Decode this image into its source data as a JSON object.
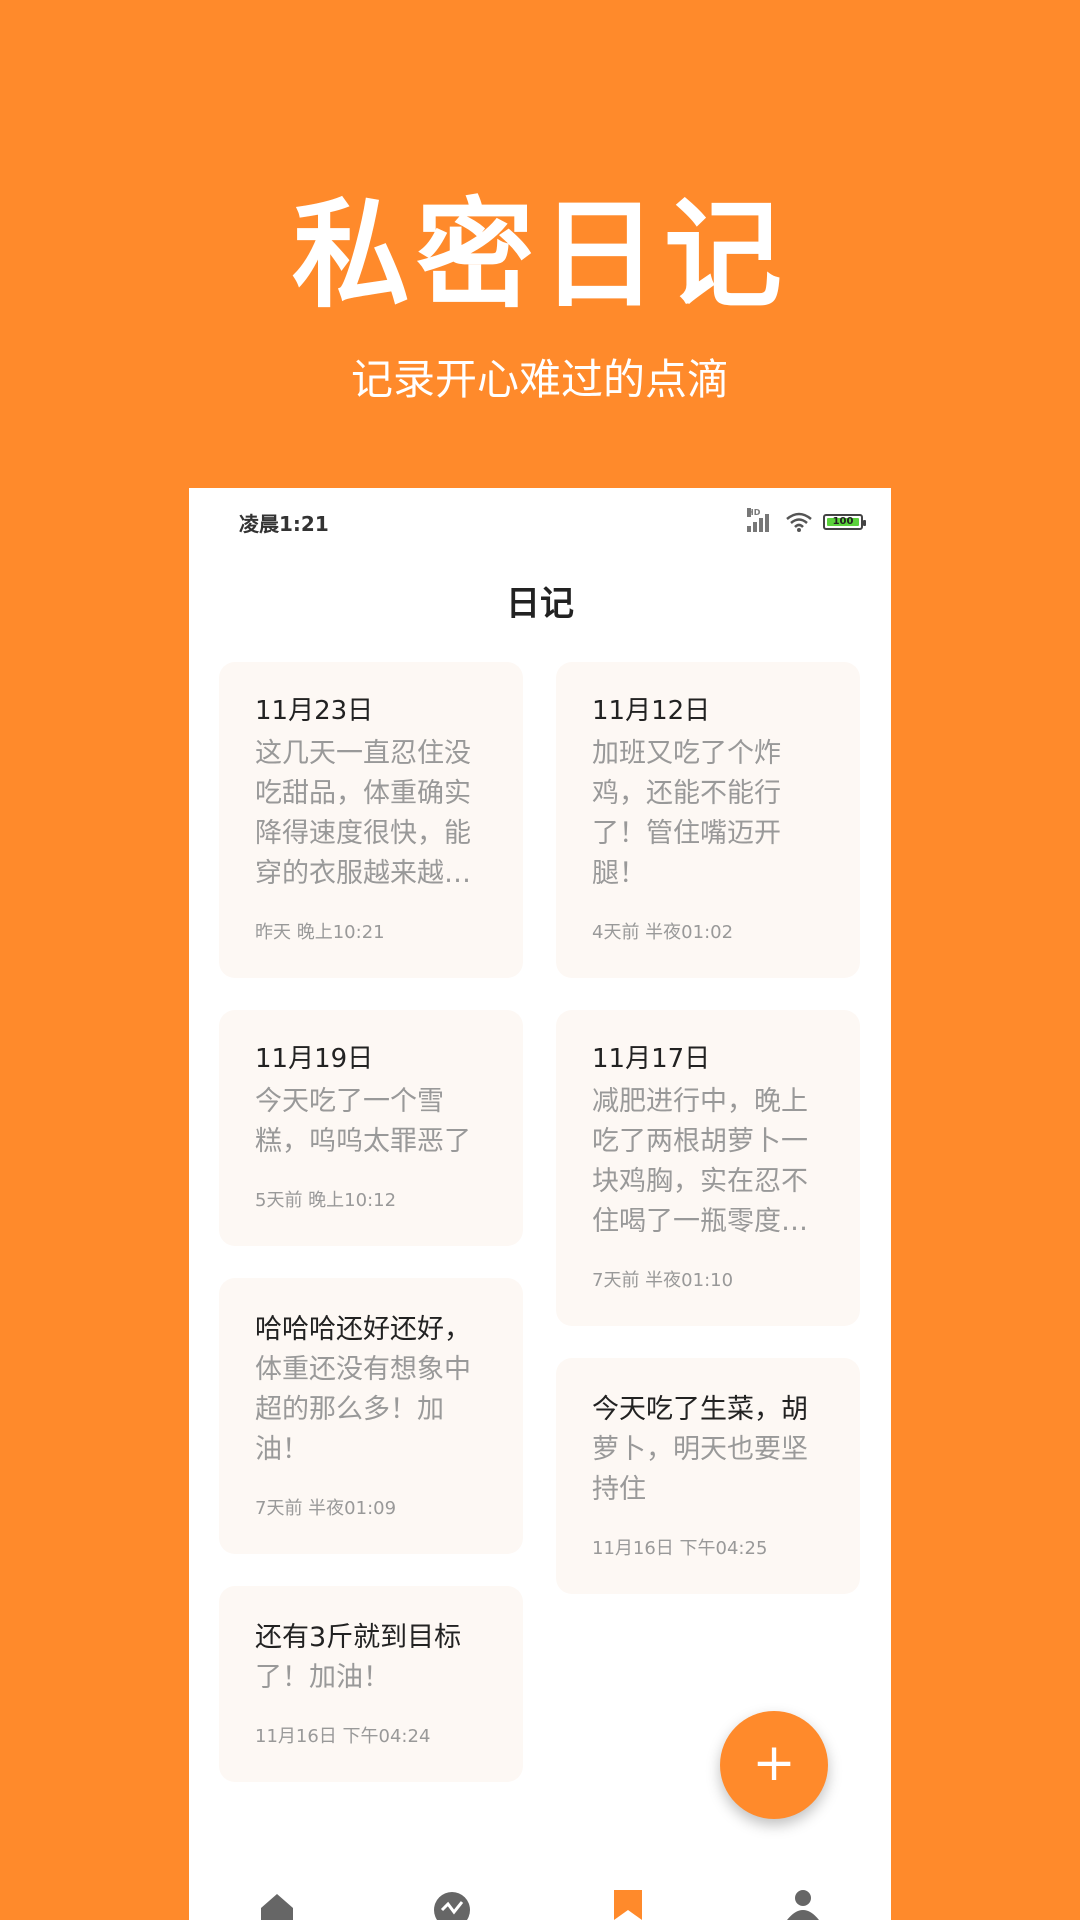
{
  "hero": {
    "title": "私密日记",
    "subtitle": "记录开心难过的点滴"
  },
  "status_bar": {
    "time": "凌晨1:21",
    "network_label": "HD",
    "battery": "100"
  },
  "header": {
    "title": "日记"
  },
  "cards": [
    {
      "date": "11月23日",
      "body": "这几天一直忍住没吃甜品，体重确实降得速度很快，能穿的衣服越来越…",
      "meta": "昨天  晚上10:21"
    },
    {
      "date": "11月12日",
      "body": "加班又吃了个炸鸡，还能不能行了！管住嘴迈开腿！",
      "meta": "4天前  半夜01:02"
    },
    {
      "date": "11月19日",
      "body": "今天吃了一个雪糕，呜呜太罪恶了",
      "meta": "5天前  晚上10:12"
    },
    {
      "date": "11月17日",
      "body": "减肥进行中，晚上吃了两根胡萝卜一块鸡胸，实在忍不住喝了一瓶零度…",
      "meta": "7天前  半夜01:10"
    },
    {
      "headline": "哈哈哈还好还好，",
      "body": "体重还没有想象中超的那么多！加油！",
      "meta": "7天前  半夜01:09"
    },
    {
      "headline": "今天吃了生菜，胡",
      "body": "萝卜，明天也要坚持住",
      "meta": "11月16日  下午04:25"
    },
    {
      "headline": "还有3斤就到目标",
      "body": "了！加油！",
      "meta": "11月16日  下午04:24"
    }
  ],
  "fab": {
    "label": "+"
  },
  "tabs": [
    {
      "icon": "home-icon"
    },
    {
      "icon": "chart-icon"
    },
    {
      "icon": "bookmark-icon"
    },
    {
      "icon": "profile-icon"
    }
  ],
  "colors": {
    "accent": "#FF8A2B",
    "card_bg": "#FDF8F4",
    "muted_text": "#999999"
  }
}
